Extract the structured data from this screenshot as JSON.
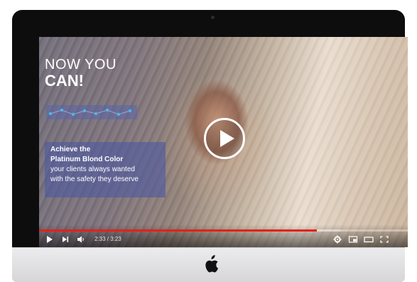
{
  "video": {
    "headline_line1": "NOW YOU",
    "headline_line2": "CAN!",
    "promo_lines": [
      "Achieve the",
      "Platinum Blond Color",
      "your clients always wanted",
      "with the safety they deserve"
    ]
  },
  "player": {
    "time_display": "2:33 / 3:23",
    "progress_fraction": 0.753,
    "loaded_fraction": 0.82,
    "icons": {
      "play": "play-icon",
      "next": "next-icon",
      "volume": "volume-icon",
      "settings": "gear-icon",
      "miniplayer": "miniplayer-icon",
      "theater": "theater-icon",
      "fullscreen": "fullscreen-icon",
      "big_play": "play-circle-icon"
    }
  },
  "device": {
    "logo_icon": "apple-logo-icon"
  },
  "colors": {
    "progress": "#e62117",
    "promo_panel": "#4e58a0",
    "dots": "#4fb7e8"
  }
}
